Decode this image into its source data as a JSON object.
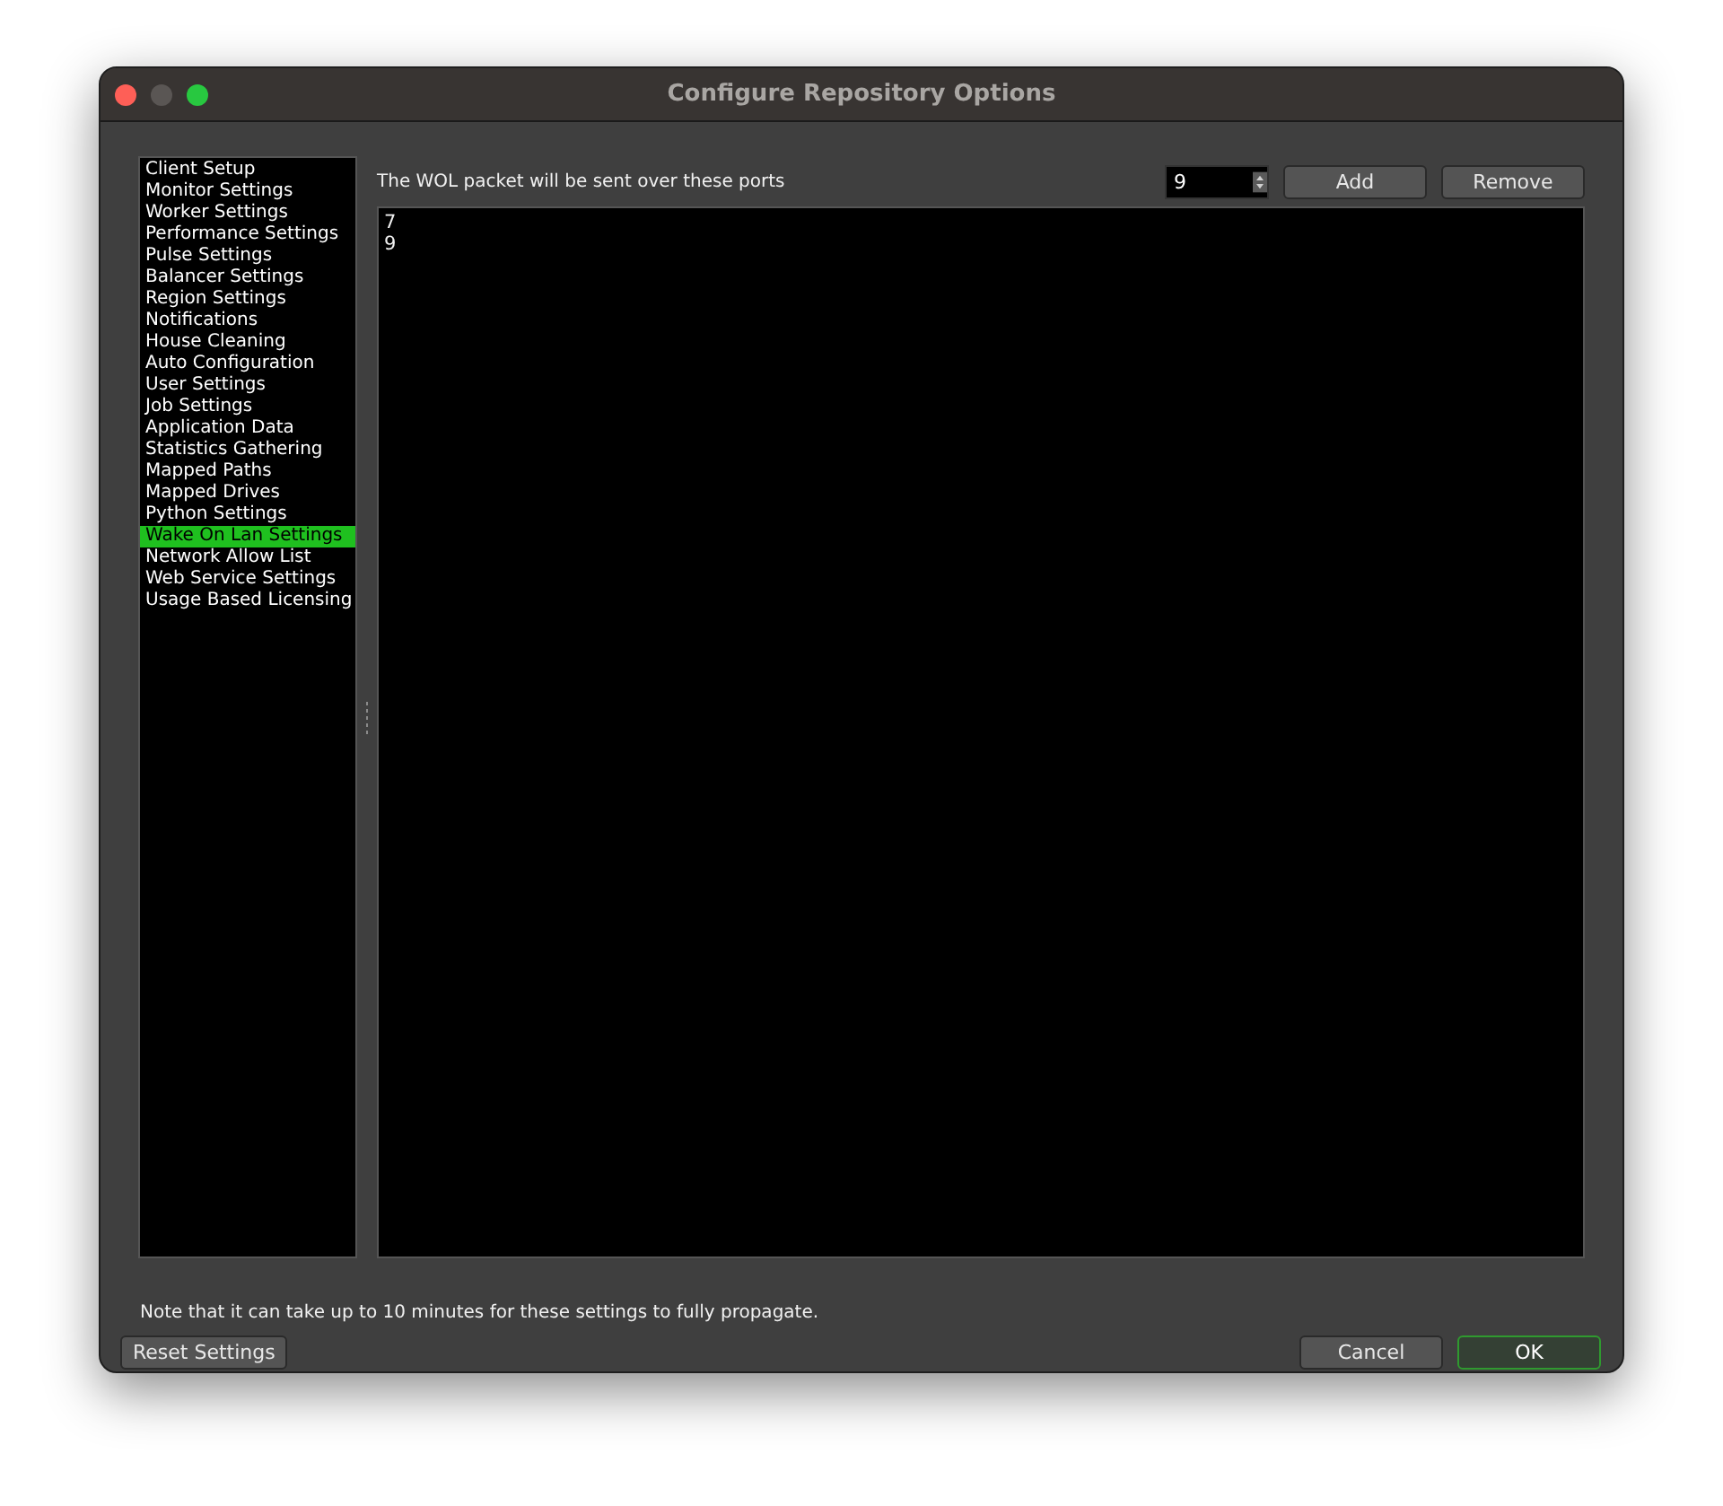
{
  "window": {
    "title": "Configure Repository Options"
  },
  "sidebar": {
    "items": [
      {
        "label": "Client Setup",
        "selected": false
      },
      {
        "label": "Monitor Settings",
        "selected": false
      },
      {
        "label": "Worker Settings",
        "selected": false
      },
      {
        "label": "Performance Settings",
        "selected": false
      },
      {
        "label": "Pulse Settings",
        "selected": false
      },
      {
        "label": "Balancer Settings",
        "selected": false
      },
      {
        "label": "Region Settings",
        "selected": false
      },
      {
        "label": "Notifications",
        "selected": false
      },
      {
        "label": "House Cleaning",
        "selected": false
      },
      {
        "label": "Auto Configuration",
        "selected": false
      },
      {
        "label": "User Settings",
        "selected": false
      },
      {
        "label": "Job Settings",
        "selected": false
      },
      {
        "label": "Application Data",
        "selected": false
      },
      {
        "label": "Statistics Gathering",
        "selected": false
      },
      {
        "label": "Mapped Paths",
        "selected": false
      },
      {
        "label": "Mapped Drives",
        "selected": false
      },
      {
        "label": "Python Settings",
        "selected": false
      },
      {
        "label": "Wake On Lan Settings",
        "selected": true
      },
      {
        "label": "Network Allow List",
        "selected": false
      },
      {
        "label": "Web Service Settings",
        "selected": false
      },
      {
        "label": "Usage Based Licensing",
        "selected": false
      }
    ]
  },
  "panel": {
    "description": "The WOL packet will be sent over these ports",
    "port_spinner": {
      "value": "9"
    },
    "buttons": [
      "Add",
      "Remove"
    ],
    "ports": [
      "7",
      "9"
    ]
  },
  "note": "Note that it can take up to 10 minutes for these settings to fully propagate.",
  "footer": {
    "reset_button": "Reset Settings",
    "cancel_button": "Cancel",
    "ok_button": "OK"
  }
}
